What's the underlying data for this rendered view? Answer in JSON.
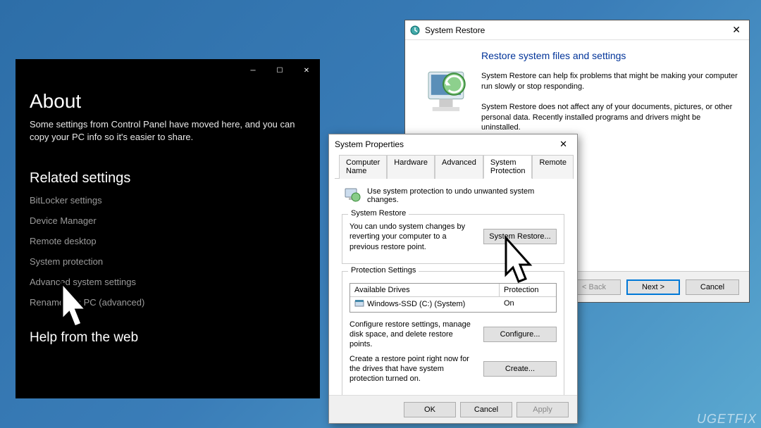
{
  "about": {
    "title": "About",
    "desc": "Some settings from Control Panel have moved here, and you can copy your PC info so it's easier to share.",
    "related_title": "Related settings",
    "links": [
      "BitLocker settings",
      "Device Manager",
      "Remote desktop",
      "System protection",
      "Advanced system settings",
      "Rename this PC (advanced)"
    ],
    "help_title": "Help from the web"
  },
  "restore": {
    "window_title": "System Restore",
    "heading": "Restore system files and settings",
    "p1": "System Restore can help fix problems that might be making your computer run slowly or stop responding.",
    "p2": "System Restore does not affect any of your documents, pictures, or other personal data. Recently installed programs and drivers might be uninstalled.",
    "back": "< Back",
    "next": "Next >",
    "cancel": "Cancel"
  },
  "sysprops": {
    "window_title": "System Properties",
    "tabs": [
      "Computer Name",
      "Hardware",
      "Advanced",
      "System Protection",
      "Remote"
    ],
    "intro": "Use system protection to undo unwanted system changes.",
    "group_restore": "System Restore",
    "restore_text": "You can undo system changes by reverting your computer to a previous restore point.",
    "restore_btn": "System Restore...",
    "group_protection": "Protection Settings",
    "col_drives": "Available Drives",
    "col_protection": "Protection",
    "drive_name": "Windows-SSD (C:) (System)",
    "drive_status": "On",
    "configure_text": "Configure restore settings, manage disk space, and delete restore points.",
    "configure_btn": "Configure...",
    "create_text": "Create a restore point right now for the drives that have system protection turned on.",
    "create_btn": "Create...",
    "ok": "OK",
    "cancel": "Cancel",
    "apply": "Apply"
  },
  "watermark": "UGETFIX"
}
